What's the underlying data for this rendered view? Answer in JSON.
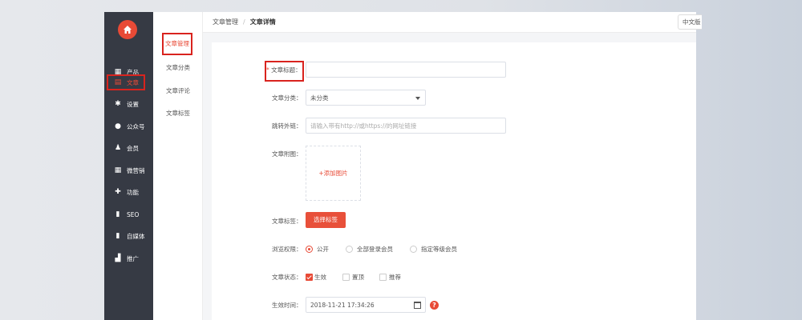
{
  "sidebar": {
    "items": [
      {
        "icon": "grid-icon",
        "glyph": "▦",
        "label": "产品"
      },
      {
        "icon": "document-icon",
        "glyph": "▤",
        "label": "文章"
      },
      {
        "icon": "gear-icon",
        "glyph": "✱",
        "label": "设置"
      },
      {
        "icon": "wechat-icon",
        "glyph": "●",
        "label": "公众号"
      },
      {
        "icon": "user-icon",
        "glyph": "♟",
        "label": "会员"
      },
      {
        "icon": "calendar-icon",
        "glyph": "▦",
        "label": "微营销"
      },
      {
        "icon": "puzzle-icon",
        "glyph": "✚",
        "label": "功能"
      },
      {
        "icon": "file-icon",
        "glyph": "▮",
        "label": "SEO"
      },
      {
        "icon": "file-icon",
        "glyph": "▮",
        "label": "自媒体"
      },
      {
        "icon": "bar-chart-icon",
        "glyph": "▟",
        "label": "推广"
      }
    ],
    "active_index": 1
  },
  "subnav": {
    "items": [
      "文章管理",
      "文章分类",
      "文章评论",
      "文章标签"
    ],
    "active_index": 0
  },
  "breadcrumb": {
    "parent": "文章管理",
    "separator": "/",
    "current": "文章详情"
  },
  "language": {
    "label": "中文版"
  },
  "form": {
    "title_label": "文章标题：",
    "title_value": "",
    "category_label": "文章分类：",
    "category_value": "未分类",
    "link_label": "跳转外链：",
    "link_placeholder": "请输入带有http://或https://的网址链接",
    "image_label": "文章附图：",
    "image_add": "+添加图片",
    "tags_label": "文章标签：",
    "tags_button": "选择标签",
    "permission_label": "浏览权限：",
    "permission_options": [
      "公开",
      "全部登录会员",
      "指定等级会员"
    ],
    "permission_selected": 0,
    "status_label": "文章状态：",
    "status_options": [
      {
        "label": "生效",
        "checked": true
      },
      {
        "label": "置顶",
        "checked": false
      },
      {
        "label": "推荐",
        "checked": false
      }
    ],
    "time_label": "生效时间：",
    "time_value": "2018-11-21 17:34:26",
    "help_glyph": "?"
  },
  "colors": {
    "accent": "#e84a36",
    "sidebar": "#363a44",
    "highlight": "#d9231e"
  }
}
